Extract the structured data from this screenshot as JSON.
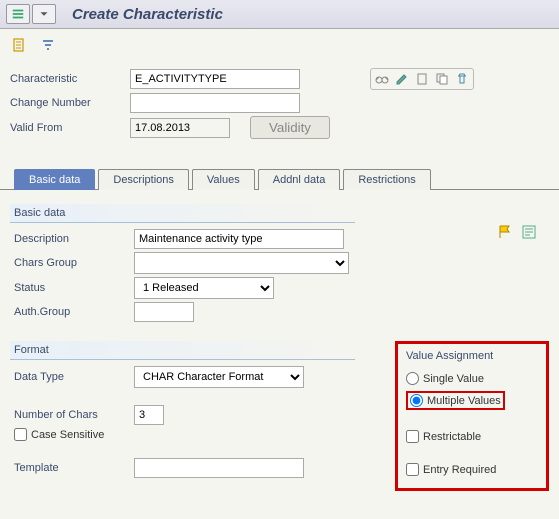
{
  "title": "Create Characteristic",
  "header": {
    "characteristic_label": "Characteristic",
    "characteristic_value": "E_ACTIVITYTYPE",
    "change_number_label": "Change Number",
    "change_number_value": "",
    "valid_from_label": "Valid From",
    "valid_from_value": "17.08.2013",
    "validity_button": "Validity"
  },
  "tabs": {
    "basic_data": "Basic data",
    "descriptions": "Descriptions",
    "values": "Values",
    "addnl_data": "Addnl data",
    "restrictions": "Restrictions"
  },
  "basic_data_group": {
    "title": "Basic data",
    "description_label": "Description",
    "description_value": "Maintenance activity type",
    "chars_group_label": "Chars Group",
    "chars_group_value": "",
    "status_label": "Status",
    "status_value": "1 Released",
    "auth_group_label": "Auth.Group",
    "auth_group_value": ""
  },
  "format_group": {
    "title": "Format",
    "data_type_label": "Data Type",
    "data_type_value": "CHAR Character Format",
    "number_chars_label": "Number of Chars",
    "number_chars_value": "3",
    "case_sensitive_label": "Case Sensitive",
    "template_label": "Template",
    "template_value": ""
  },
  "value_assignment": {
    "title": "Value Assignment",
    "single_value": "Single Value",
    "multiple_values": "Multiple Values",
    "restrictable": "Restrictable",
    "entry_required": "Entry Required"
  }
}
